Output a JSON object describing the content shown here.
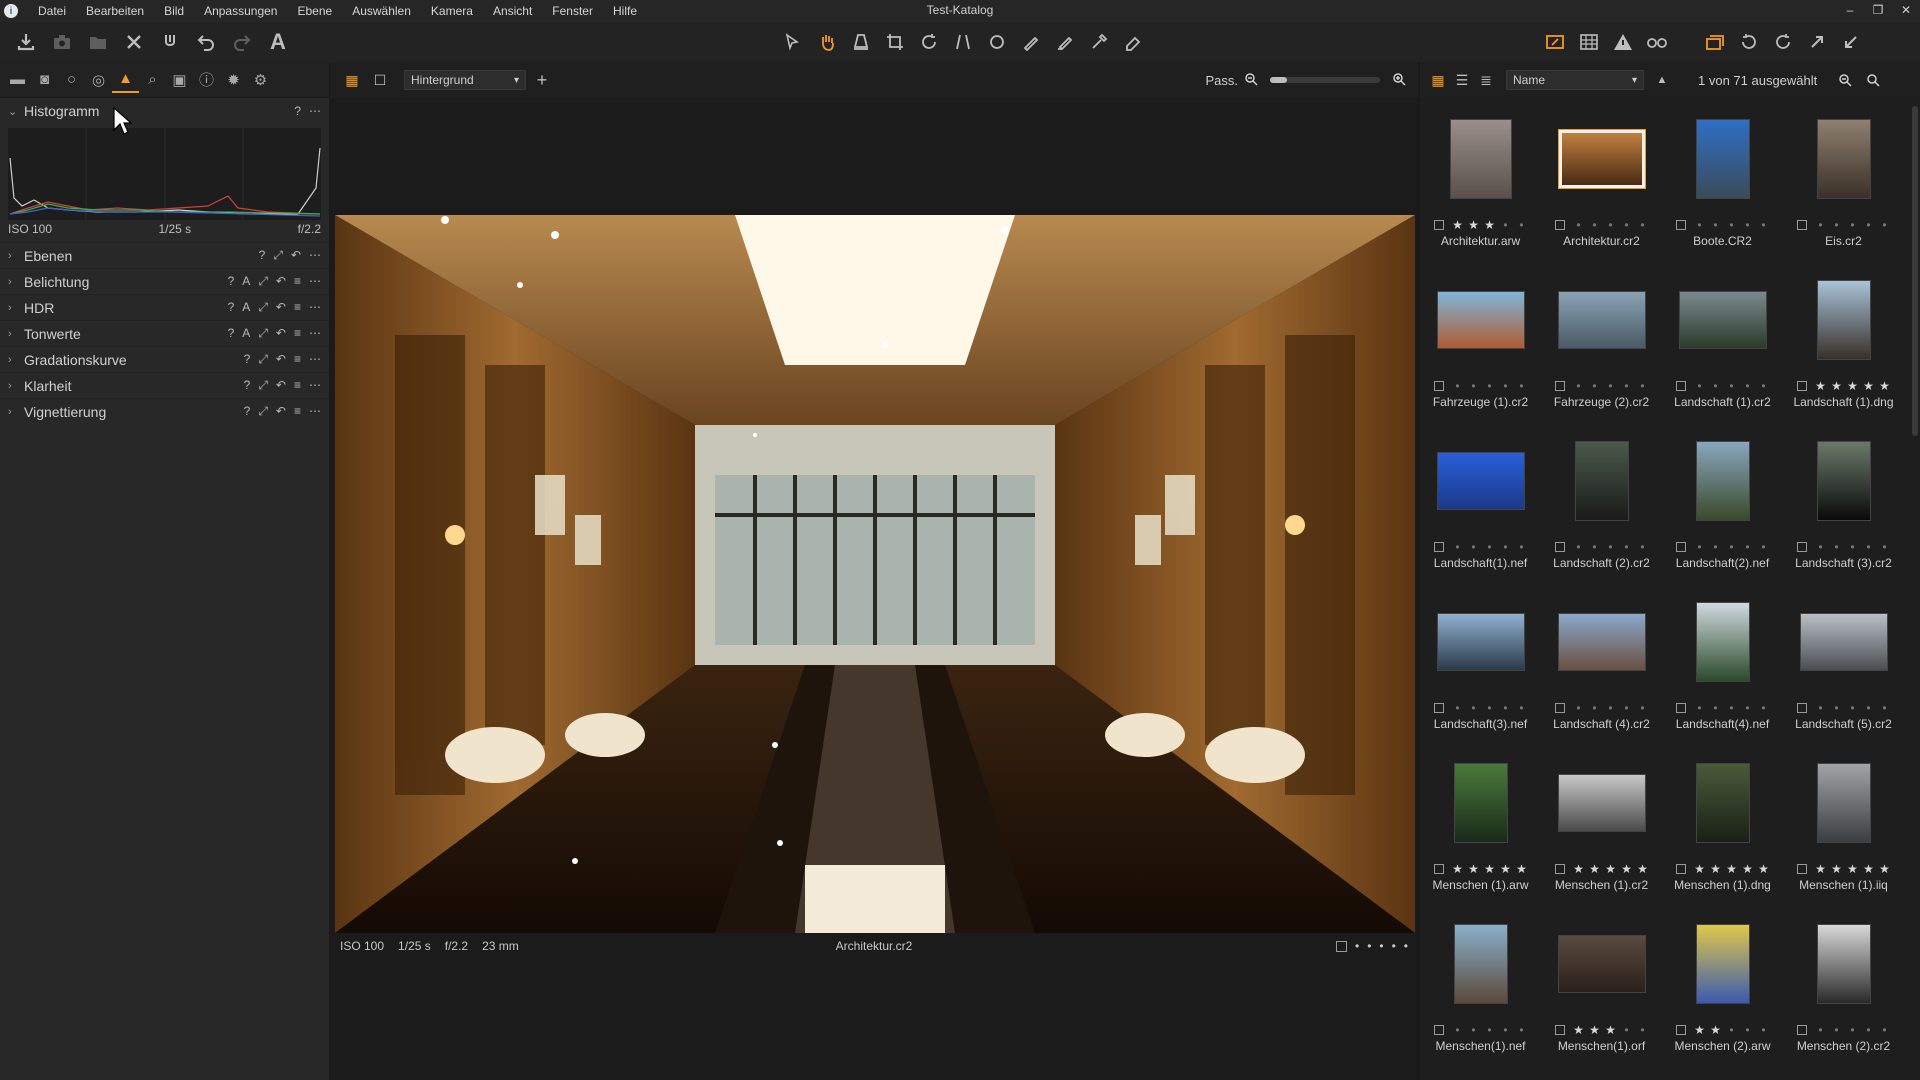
{
  "app": {
    "window_title": "Test-Katalog",
    "menu": [
      "Datei",
      "Bearbeiten",
      "Bild",
      "Anpassungen",
      "Ebene",
      "Auswählen",
      "Kamera",
      "Ansicht",
      "Fenster",
      "Hilfe"
    ],
    "window_controls": [
      "–",
      "❐",
      "✕"
    ]
  },
  "colors": {
    "accent": "#f59a23",
    "panel": "#282828",
    "background": "#1b1b1b"
  },
  "left_panel": {
    "tool_tabs": [
      "library-icon",
      "capture-icon",
      "lens-icon",
      "color-icon",
      "exposure-icon",
      "details-icon",
      "adjustments-icon",
      "metadata-icon",
      "output-icon",
      "batch-icon"
    ],
    "histogram": {
      "title": "Histogramm",
      "help": "?",
      "menu": "⋯",
      "iso": "ISO 100",
      "shutter": "1/25 s",
      "aperture": "f/2.2"
    },
    "tools": [
      {
        "label": "Ebenen",
        "actions": [
          "?",
          "⤢",
          "↶",
          "⋯"
        ]
      },
      {
        "label": "Belichtung",
        "actions": [
          "?",
          "A",
          "⤢",
          "↶",
          "≡",
          "⋯"
        ]
      },
      {
        "label": "HDR",
        "actions": [
          "?",
          "A",
          "⤢",
          "↶",
          "≡",
          "⋯"
        ]
      },
      {
        "label": "Tonwerte",
        "actions": [
          "?",
          "A",
          "⤢",
          "↶",
          "≡",
          "⋯"
        ]
      },
      {
        "label": "Gradationskurve",
        "actions": [
          "?",
          "⤢",
          "↶",
          "≡",
          "⋯"
        ]
      },
      {
        "label": "Klarheit",
        "actions": [
          "?",
          "⤢",
          "↶",
          "≡",
          "⋯"
        ]
      },
      {
        "label": "Vignettierung",
        "actions": [
          "?",
          "⤢",
          "↶",
          "≡",
          "⋯"
        ]
      }
    ]
  },
  "viewer": {
    "variant": "Hintergrund",
    "add": "+",
    "zoom_label": "Pass.",
    "zoom_level": 0.15,
    "caption": {
      "iso": "ISO 100",
      "shutter": "1/25 s",
      "aperture": "f/2.2",
      "focal": "23 mm",
      "filename": "Architektur.cr2"
    }
  },
  "browser": {
    "sort": "Name",
    "selection": "1 von 71 ausgewählt",
    "items": [
      {
        "name": "Architektur.arw",
        "rating": 3,
        "w": 62,
        "h": 80,
        "c1": "#9a8f8a",
        "c2": "#5a504a",
        "selected": false
      },
      {
        "name": "Architektur.cr2",
        "rating": 0,
        "w": 86,
        "h": 58,
        "c1": "#c08040",
        "c2": "#4a2a12",
        "selected": true
      },
      {
        "name": "Boote.CR2",
        "rating": 0,
        "w": 54,
        "h": 80,
        "c1": "#2f6fc4",
        "c2": "#3a4b5a",
        "selected": false
      },
      {
        "name": "Eis.cr2",
        "rating": 0,
        "w": 54,
        "h": 80,
        "c1": "#8f8070",
        "c2": "#3a3028",
        "selected": false
      },
      {
        "name": "Fahrzeuge (1).cr2",
        "rating": 0,
        "w": 88,
        "h": 58,
        "c1": "#7fb6d8",
        "c2": "#b05a32",
        "selected": false
      },
      {
        "name": "Fahrzeuge (2).cr2",
        "rating": 0,
        "w": 88,
        "h": 58,
        "c1": "#8aa2b4",
        "c2": "#4a5a66",
        "selected": false
      },
      {
        "name": "Landschaft (1).cr2",
        "rating": 0,
        "w": 88,
        "h": 58,
        "c1": "#7a8a8c",
        "c2": "#2c3a2a",
        "selected": false
      },
      {
        "name": "Landschaft (1).dng",
        "rating": 5,
        "w": 54,
        "h": 80,
        "c1": "#a8c2d8",
        "c2": "#38302a",
        "selected": false
      },
      {
        "name": "Landschaft(1).nef",
        "rating": 0,
        "w": 88,
        "h": 58,
        "c1": "#2a5fd8",
        "c2": "#1a3a8a",
        "selected": false
      },
      {
        "name": "Landschaft (2).cr2",
        "rating": 0,
        "w": 54,
        "h": 80,
        "c1": "#4a5a4a",
        "c2": "#1a1a1a",
        "selected": false
      },
      {
        "name": "Landschaft(2).nef",
        "rating": 0,
        "w": 54,
        "h": 80,
        "c1": "#8aa6c0",
        "c2": "#3a4a2a",
        "selected": false
      },
      {
        "name": "Landschaft (3).cr2",
        "rating": 0,
        "w": 54,
        "h": 80,
        "c1": "#6a7a6a",
        "c2": "#0a0a0a",
        "selected": false
      },
      {
        "name": "Landschaft(3).nef",
        "rating": 0,
        "w": 88,
        "h": 58,
        "c1": "#90b0d0",
        "c2": "#2a3a4a",
        "selected": false
      },
      {
        "name": "Landschaft (4).cr2",
        "rating": 0,
        "w": 88,
        "h": 58,
        "c1": "#8aa8cc",
        "c2": "#6a5040",
        "selected": false
      },
      {
        "name": "Landschaft(4).nef",
        "rating": 0,
        "w": 54,
        "h": 80,
        "c1": "#d0d8e0",
        "c2": "#2a4a2a",
        "selected": false
      },
      {
        "name": "Landschaft (5).cr2",
        "rating": 0,
        "w": 88,
        "h": 58,
        "c1": "#b8c0c6",
        "c2": "#4a4e52",
        "selected": false
      },
      {
        "name": "Menschen (1).arw",
        "rating": 5,
        "w": 54,
        "h": 80,
        "c1": "#4a7a3a",
        "c2": "#1a2a1a",
        "selected": false
      },
      {
        "name": "Menschen (1).cr2",
        "rating": 5,
        "w": 88,
        "h": 58,
        "c1": "#c8c8c8",
        "c2": "#4a4a4a",
        "selected": false
      },
      {
        "name": "Menschen (1).dng",
        "rating": 5,
        "w": 54,
        "h": 80,
        "c1": "#4a5a3a",
        "c2": "#1a2016",
        "selected": false
      },
      {
        "name": "Menschen (1).iiq",
        "rating": 5,
        "w": 54,
        "h": 80,
        "c1": "#a0a4a6",
        "c2": "#3a3e40",
        "selected": false
      },
      {
        "name": "Menschen(1).nef",
        "rating": 0,
        "w": 54,
        "h": 80,
        "c1": "#8ab0cc",
        "c2": "#5a4a3a",
        "selected": false
      },
      {
        "name": "Menschen(1).orf",
        "rating": 3,
        "w": 88,
        "h": 58,
        "c1": "#5a4a40",
        "c2": "#2a201a",
        "selected": false
      },
      {
        "name": "Menschen (2).arw",
        "rating": 2,
        "w": 54,
        "h": 80,
        "c1": "#e0c84a",
        "c2": "#3a5ab0",
        "selected": false
      },
      {
        "name": "Menschen (2).cr2",
        "rating": 0,
        "w": 54,
        "h": 80,
        "c1": "#d8d8d8",
        "c2": "#2a2a2a",
        "selected": false
      }
    ]
  }
}
